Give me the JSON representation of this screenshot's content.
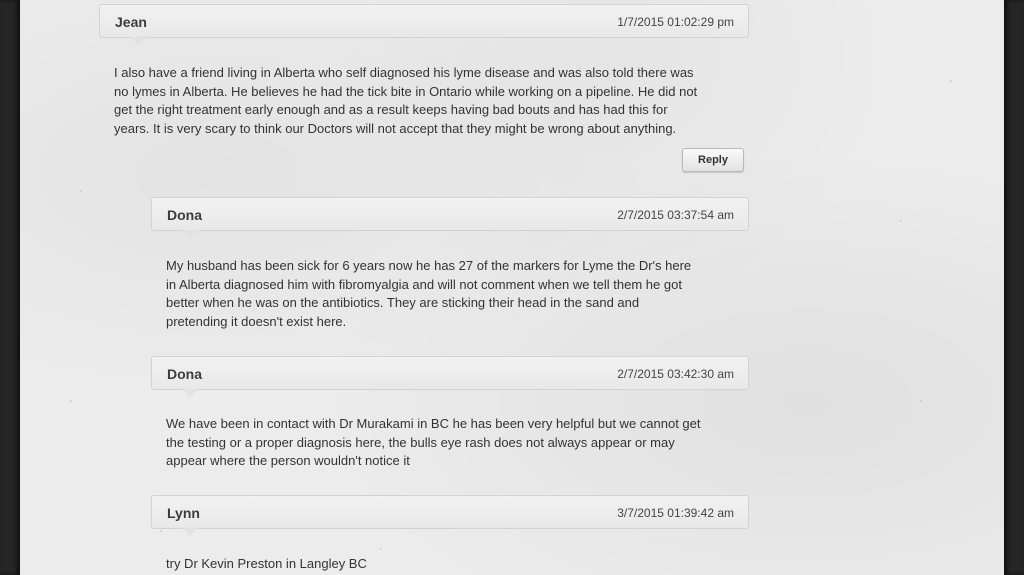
{
  "comments": [
    {
      "author": "Jean",
      "timestamp": "1/7/2015 01:02:29 pm",
      "body": "I also have a friend living in Alberta who self diagnosed his lyme disease and was also told there was\nno lymes in Alberta. He believes he had the tick bite in Ontario while working on a pipeline. He did not\nget the right treatment early enough and as a result keeps having bad bouts and has had this for\nyears. It is very scary to think our Doctors will not accept that they might be wrong about anything."
    },
    {
      "author": "Dona",
      "timestamp": "2/7/2015 03:37:54 am",
      "body": "My husband has been sick for 6 years now he has 27 of the markers for Lyme the Dr's here\nin Alberta diagnosed him with fibromyalgia and will not comment when we tell them he got\nbetter when he was on the antibiotics. They are sticking their head in the sand and\npretending it doesn't exist here."
    },
    {
      "author": "Dona",
      "timestamp": "2/7/2015 03:42:30 am",
      "body": "We have been in contact with Dr Murakami in BC he has been very helpful but we cannot get\nthe testing or a proper diagnosis here, the bulls eye rash does not always appear or may\nappear where the person wouldn't notice it"
    },
    {
      "author": "Lynn",
      "timestamp": "3/7/2015 01:39:42 am",
      "body": "try Dr Kevin Preston in Langley BC"
    }
  ],
  "reply_label": "Reply"
}
